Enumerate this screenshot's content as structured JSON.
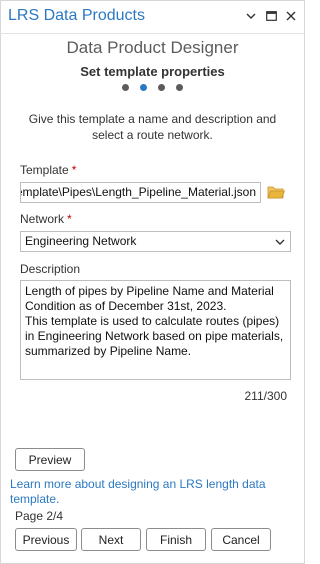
{
  "window": {
    "title": "LRS Data Products"
  },
  "header": {
    "designer_title": "Data Product Designer",
    "step_title": "Set template properties",
    "steps_total": 4,
    "steps_active_index": 1
  },
  "intro": "Give this template a name and description and select a route network.",
  "template": {
    "label": "Template",
    "required": "*",
    "value": "emplate\\Pipes\\Length_Pipeline_Material.json"
  },
  "network": {
    "label": "Network",
    "required": "*",
    "selected": "Engineering Network"
  },
  "description": {
    "label": "Description",
    "value": "Length of pipes by Pipeline Name and Material Condition as of December 31st, 2023.\nThis template is used to calculate routes (pipes) in Engineering Network based on pipe materials, summarized by Pipeline Name.",
    "count": "211/300"
  },
  "buttons": {
    "preview": "Preview",
    "previous": "Previous",
    "next": "Next",
    "finish": "Finish",
    "cancel": "Cancel"
  },
  "help_link": "Learn more about designing an LRS length data template.",
  "page_indicator": "Page 2/4",
  "icons": {
    "dropdown": "chevron-down-icon",
    "maximize": "maximize-icon",
    "close": "close-icon",
    "browse": "folder-icon"
  },
  "colors": {
    "accent": "#2b79c2",
    "required": "#c00000",
    "folder": "#e8b43c"
  }
}
